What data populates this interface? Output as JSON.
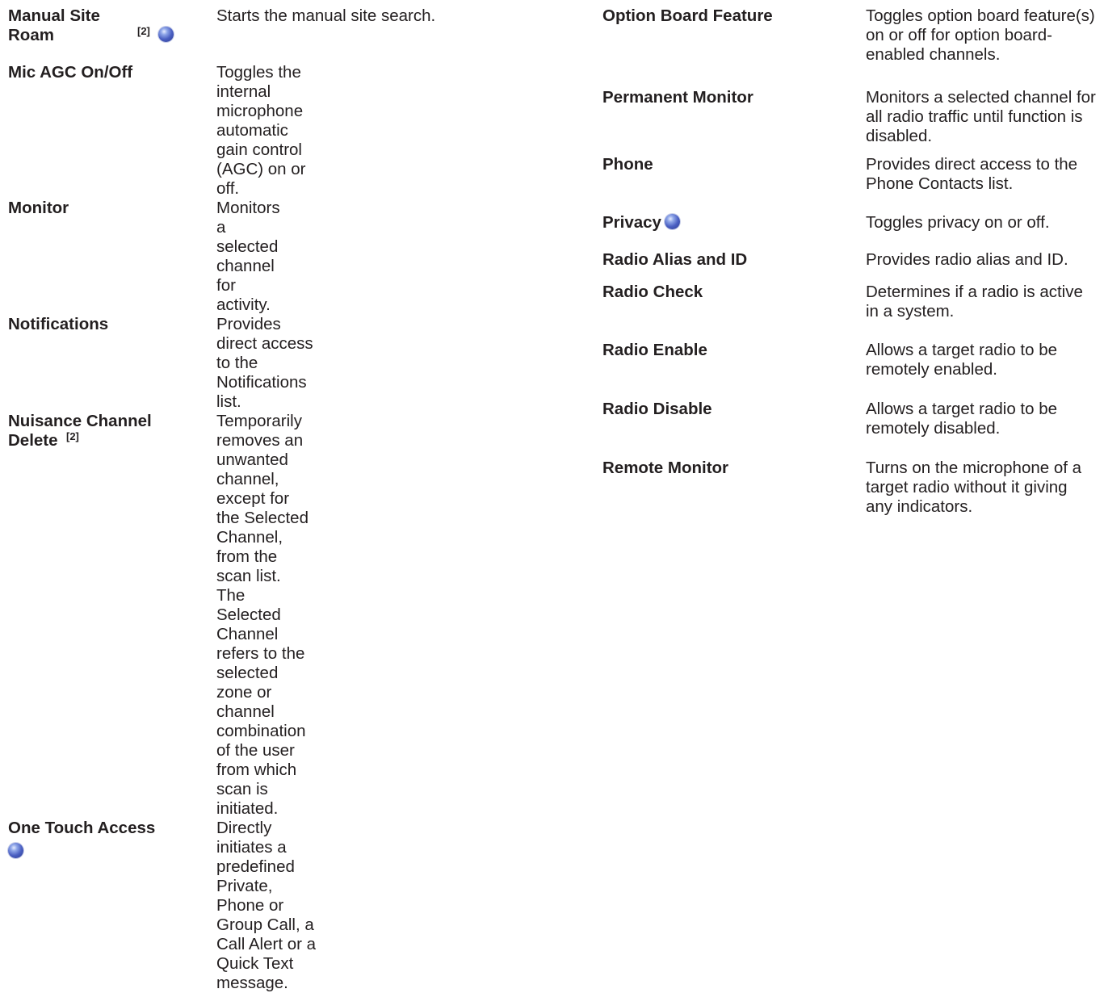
{
  "left_column": [
    {
      "term": "Manual Site Roam",
      "footnote": "[2]",
      "icon": "globe-icon",
      "description": "Starts the manual site search."
    },
    {
      "term": "Mic AGC On/Off",
      "description": "Toggles the internal microphone automatic gain control (AGC) on or off."
    },
    {
      "term": "Monitor",
      "description": "Monitors a selected channel for activity."
    },
    {
      "term": "Notifications",
      "description": "Provides direct access to the Notifications list."
    },
    {
      "term": "Nuisance Channel Delete",
      "footnote": "[2]",
      "description": "Temporarily removes an unwanted channel, except for the Selected Channel, from the scan list. The Selected Channel refers to the selected zone or channel combination of the user from which scan is initiated."
    },
    {
      "term": "One Touch Access",
      "icon": "globe-icon",
      "description": "Directly initiates a predefined Private, Phone or Group Call, a Call Alert or a Quick Text message."
    }
  ],
  "right_column": [
    {
      "term": "Option Board Feature",
      "description": "Toggles option board feature(s) on or off for option board-enabled channels."
    },
    {
      "term": "Permanent Monitor",
      "description": "Monitors a selected channel for all radio traffic until function is disabled."
    },
    {
      "term": "Phone",
      "description": "Provides direct access to the Phone Contacts list."
    },
    {
      "term": "Privacy",
      "icon": "globe-icon",
      "description": "Toggles privacy on or off."
    },
    {
      "term": "Radio Alias and ID",
      "description": "Provides radio alias and ID."
    },
    {
      "term": "Radio Check",
      "description": "Determines if a radio is active in a system."
    },
    {
      "term": "Radio Enable",
      "description": "Allows a target radio to be remotely enabled."
    },
    {
      "term": "Radio Disable",
      "description": "Allows a target radio to be remotely disabled."
    },
    {
      "term": "Remote Monitor",
      "description": "Turns on the microphone of a target radio without it giving any indicators."
    }
  ]
}
